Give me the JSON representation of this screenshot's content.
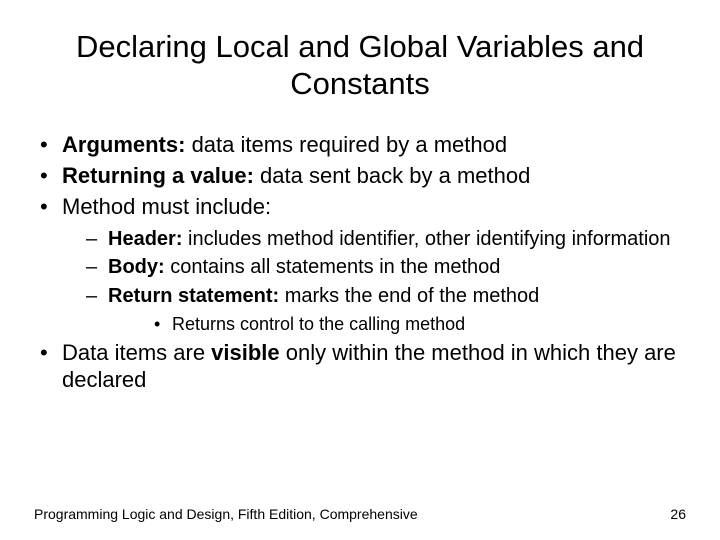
{
  "title": "Declaring Local and Global Variables and Constants",
  "bullets": {
    "b1": {
      "bold": "Arguments:",
      "rest": " data items required by a method"
    },
    "b2": {
      "bold": "Returning a value:",
      "rest": " data sent back by a method"
    },
    "b3": {
      "text": "Method must include:"
    },
    "s1": {
      "bold": "Header:",
      "rest": " includes method identifier, other identifying information"
    },
    "s2": {
      "bold": "Body:",
      "rest": " contains all statements in the method"
    },
    "s3": {
      "bold": "Return statement:",
      "rest": " marks the end of the method"
    },
    "ss1": {
      "text": "Returns control to the calling method"
    },
    "b4": {
      "pre": "Data items are ",
      "bold": "visible",
      "post": " only within the method in which they are declared"
    }
  },
  "footer": {
    "left": "Programming Logic and Design, Fifth Edition, Comprehensive",
    "right": "26"
  }
}
